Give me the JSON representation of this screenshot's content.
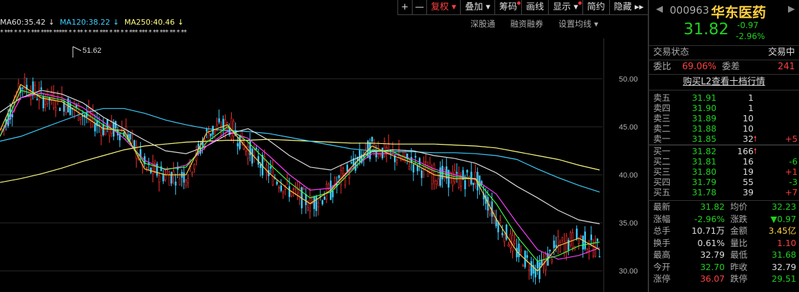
{
  "toolbar": {
    "items": [
      "+",
      "—",
      "复权",
      "叠加",
      "筹码",
      "画线",
      "显示",
      "简约",
      "隐藏"
    ],
    "collapse": "▸▸"
  },
  "ma_labels": [
    {
      "text": "MA60:35.42",
      "arrow": "↓",
      "color": "#e0e0e0"
    },
    {
      "text": "MA120:38.22",
      "arrow": "↓",
      "color": "#3ccfff"
    },
    {
      "text": "MA250:40.46",
      "arrow": "↓",
      "color": "#ffff80"
    }
  ],
  "subtabs": [
    "深股通",
    "融资融券",
    "设置均线"
  ],
  "stars": "* *** * * * * *** **** ***** * * ** * * ** *** * ** * * *** *** * ** *** ** * **",
  "price_axis": [
    "50.00",
    "45.00",
    "40.00",
    "35.00",
    "30.00"
  ],
  "high_marker": "51.62",
  "stock": {
    "code": "000963",
    "name": "华东医药",
    "price": "31.82",
    "change": "-0.97",
    "change_pct": "-2.96%"
  },
  "trade_status": {
    "label": "交易状态",
    "value": "交易中"
  },
  "ratio": {
    "label1": "委比",
    "value1": "69.06%",
    "label2": "委差",
    "value2": "241"
  },
  "ten_levels": "购买L2查看十档行情",
  "asks": [
    {
      "label": "卖五",
      "price": "31.91",
      "vol": "1",
      "arrow": "",
      "delta": ""
    },
    {
      "label": "卖四",
      "price": "31.90",
      "vol": "1",
      "arrow": "",
      "delta": ""
    },
    {
      "label": "卖三",
      "price": "31.89",
      "vol": "10",
      "arrow": "",
      "delta": ""
    },
    {
      "label": "卖二",
      "price": "31.88",
      "vol": "10",
      "arrow": "",
      "delta": ""
    },
    {
      "label": "卖一",
      "price": "31.85",
      "vol": "32",
      "arrow": "🠕",
      "delta": "+5"
    }
  ],
  "bids": [
    {
      "label": "买一",
      "price": "31.82",
      "vol": "166",
      "arrow": "🠕",
      "delta": ""
    },
    {
      "label": "买二",
      "price": "31.81",
      "vol": "16",
      "arrow": "",
      "delta": "-6"
    },
    {
      "label": "买三",
      "price": "31.80",
      "vol": "19",
      "arrow": "",
      "delta": "+1"
    },
    {
      "label": "买四",
      "price": "31.79",
      "vol": "55",
      "arrow": "",
      "delta": "-3"
    },
    {
      "label": "买五",
      "price": "31.78",
      "vol": "39",
      "arrow": "",
      "delta": "+7"
    }
  ],
  "stats": [
    {
      "l1": "最新",
      "v1": "31.82",
      "c1": "green",
      "l2": "均价",
      "v2": "32.23",
      "c2": "green"
    },
    {
      "l1": "涨幅",
      "v1": "-2.96%",
      "c1": "green",
      "l2": "涨跌",
      "v2": "▼0.97",
      "c2": "green"
    },
    {
      "l1": "总手",
      "v1": "10.71万",
      "c1": "white",
      "l2": "金额",
      "v2": "3.45亿",
      "c2": "yellow"
    },
    {
      "l1": "换手",
      "v1": "0.61%",
      "c1": "white",
      "l2": "量比",
      "v2": "1.10",
      "c2": "red"
    },
    {
      "l1": "最高",
      "v1": "32.79",
      "c1": "white",
      "l2": "最低",
      "v2": "31.68",
      "c2": "green"
    },
    {
      "l1": "今开",
      "v1": "32.70",
      "c1": "green",
      "l2": "昨收",
      "v2": "32.79",
      "c2": "white"
    },
    {
      "l1": "涨停",
      "v1": "36.07",
      "c1": "red",
      "l2": "跌停",
      "v2": "29.51",
      "c2": "green"
    }
  ],
  "chart_data": {
    "type": "line",
    "ylim": [
      27.8,
      54.2
    ],
    "ticks": [
      50,
      45,
      40,
      35,
      30
    ],
    "series": [
      {
        "name": "MA250",
        "color": "#ffff80",
        "values": [
          39.2,
          39.6,
          40.1,
          40.7,
          41.4,
          42.0,
          42.6,
          43.0,
          43.2,
          43.4,
          43.5,
          43.6,
          43.6,
          43.7,
          43.6,
          43.5,
          43.4,
          43.3,
          43.3,
          43.2,
          43.2,
          43.2,
          43.1,
          43.0,
          42.8,
          42.4,
          42.0,
          41.6,
          41.0,
          40.5
        ]
      },
      {
        "name": "MA120",
        "color": "#3ccfff",
        "values": [
          43.5,
          44.0,
          44.8,
          45.6,
          46.4,
          46.9,
          46.9,
          46.4,
          45.7,
          45.2,
          44.8,
          44.6,
          44.5,
          44.3,
          43.9,
          43.5,
          43.1,
          42.7,
          42.5,
          42.4,
          42.4,
          42.3,
          42.3,
          42.2,
          42.0,
          41.6,
          40.6,
          39.7,
          38.9,
          38.2
        ]
      },
      {
        "name": "MA60",
        "color": "#e0e0e0",
        "values": [
          46.5,
          48.0,
          48.8,
          48.4,
          47.5,
          46.0,
          44.8,
          43.6,
          42.5,
          42.2,
          43.0,
          44.2,
          44.8,
          43.6,
          42.0,
          40.8,
          40.5,
          41.5,
          42.4,
          42.6,
          42.5,
          42.0,
          41.7,
          41.2,
          40.2,
          38.8,
          37.6,
          36.3,
          35.3,
          34.9
        ]
      },
      {
        "name": "MA20",
        "color": "#ff40ff",
        "values": [
          44.0,
          48.0,
          48.5,
          48.0,
          47.0,
          45.5,
          43.8,
          41.5,
          40.5,
          41.0,
          43.0,
          44.5,
          43.8,
          42.0,
          40.0,
          38.4,
          38.6,
          40.6,
          42.2,
          42.2,
          41.6,
          40.6,
          40.0,
          39.5,
          38.0,
          35.0,
          32.2,
          31.2,
          31.6,
          32.4
        ]
      },
      {
        "name": "MA10",
        "color": "#40ff40",
        "values": [
          44.0,
          48.8,
          48.2,
          47.8,
          46.6,
          45.2,
          44.2,
          41.2,
          40.6,
          40.8,
          43.4,
          45.0,
          43.4,
          41.2,
          39.2,
          37.6,
          38.2,
          40.4,
          42.6,
          42.4,
          41.4,
          40.4,
          39.8,
          39.6,
          37.0,
          33.6,
          31.0,
          31.6,
          32.6,
          33.0
        ]
      },
      {
        "name": "MA5",
        "color": "#ffd040",
        "values": [
          44.6,
          49.4,
          48.0,
          47.6,
          46.2,
          44.8,
          44.6,
          40.6,
          40.0,
          40.0,
          44.4,
          45.2,
          42.6,
          40.2,
          38.4,
          37.0,
          38.4,
          40.8,
          43.0,
          42.0,
          41.2,
          40.0,
          39.6,
          39.6,
          35.4,
          32.0,
          30.0,
          32.6,
          33.4,
          32.2
        ]
      }
    ]
  }
}
